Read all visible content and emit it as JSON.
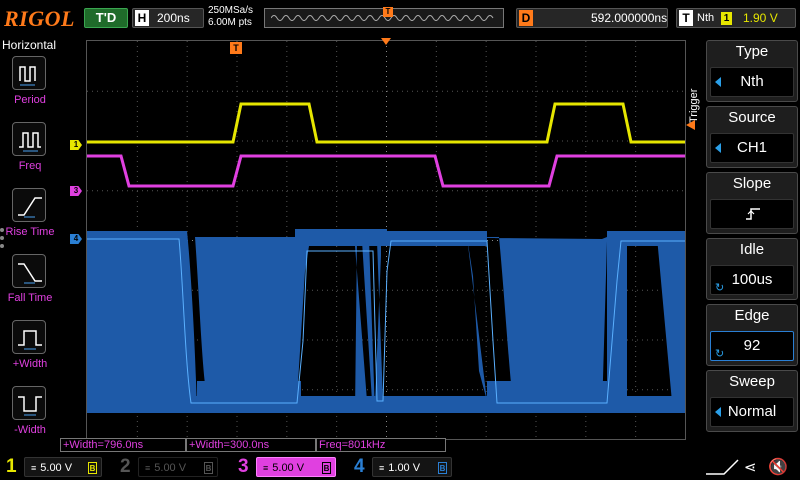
{
  "topbar": {
    "logo": "RIGOL",
    "run_status": "T'D",
    "timebase_tag": "H",
    "timebase": "200ns",
    "sample_rate": "250MSa/s",
    "memory_depth": "6.00M pts",
    "delay_tag": "D",
    "delay": "592.000000ns",
    "trigger_tag": "T",
    "trigger_mode": "Nth",
    "trigger_source": "1",
    "trigger_level": "1.90 V"
  },
  "left_panel": {
    "title": "Horizontal",
    "items": [
      {
        "label": "Period",
        "icon": "period-icon"
      },
      {
        "label": "Freq",
        "icon": "freq-icon"
      },
      {
        "label": "Rise Time",
        "icon": "rise-time-icon"
      },
      {
        "label": "Fall Time",
        "icon": "fall-time-icon"
      },
      {
        "label": "+Width",
        "icon": "pos-width-icon"
      },
      {
        "label": "-Width",
        "icon": "neg-width-icon"
      }
    ]
  },
  "trigger_menu": {
    "title": "Trigger",
    "type": {
      "label": "Type",
      "value": "Nth"
    },
    "source": {
      "label": "Source",
      "value": "CH1"
    },
    "slope": {
      "label": "Slope",
      "icon": "rising-edge-icon"
    },
    "idle": {
      "label": "Idle",
      "value": "100us"
    },
    "edge": {
      "label": "Edge",
      "value": "92"
    },
    "sweep": {
      "label": "Sweep",
      "value": "Normal"
    }
  },
  "measurements": [
    {
      "text": "+Width=796.0ns"
    },
    {
      "text": "+Width=300.0ns"
    },
    {
      "text": "Freq=801kHz"
    }
  ],
  "channels": [
    {
      "num": "1",
      "scale": "5.00 V",
      "color": "#e6e600",
      "active": true
    },
    {
      "num": "2",
      "scale": "5.00 V",
      "color": "#555555",
      "active": false
    },
    {
      "num": "3",
      "scale": "5.00 V",
      "color": "#e040e0",
      "active": true
    },
    {
      "num": "4",
      "scale": "1.00 V",
      "color": "#2a7fd4",
      "active": true
    }
  ],
  "markers": {
    "ch1": "1",
    "ch3": "3",
    "ch4": "4",
    "trigger_position": "T"
  },
  "colors": {
    "ch1": "#e6e600",
    "ch3": "#e040e0",
    "ch4": "#1e5aa8",
    "ch4_line": "#4aa0f0",
    "accent": "#ff7a1a"
  }
}
